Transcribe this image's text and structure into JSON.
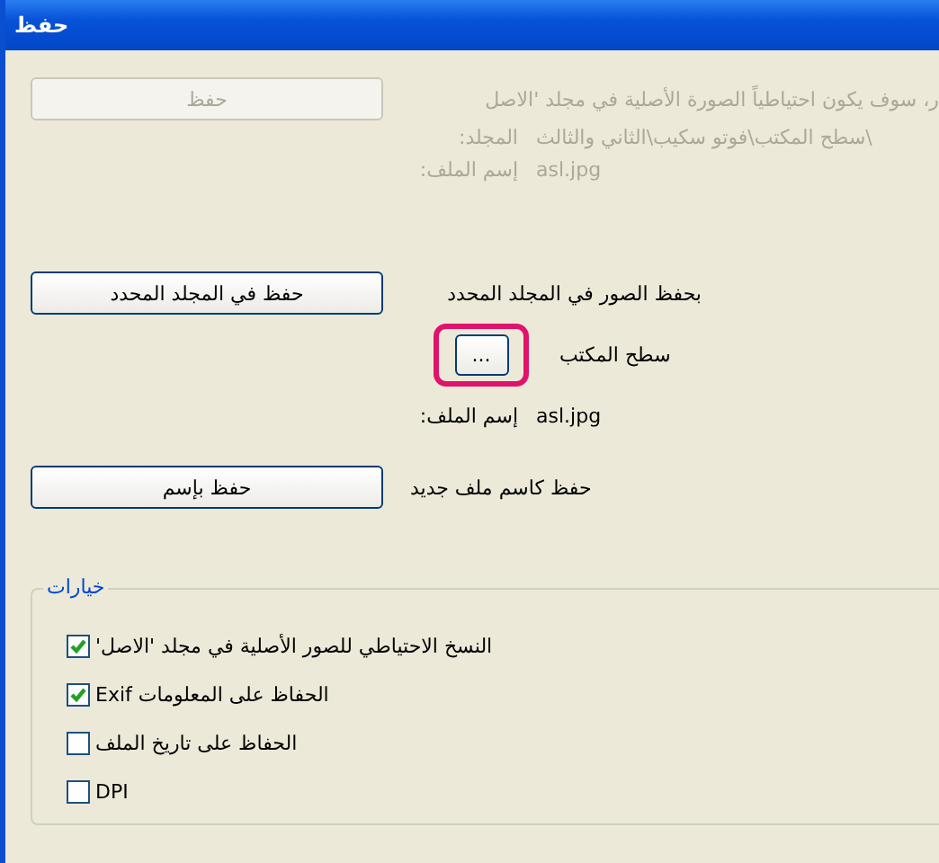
{
  "window": {
    "title": "حفظ"
  },
  "overwrite": {
    "disabled": true,
    "button": "حفظ",
    "description": "ر، سوف يكون احتياطياً الصورة الأصلية في مجلد 'الاصل",
    "fields": [
      {
        "label": "المجلد:",
        "value": "\\سطح المكتب\\فوتو سكيب\\الثاني والثالث"
      },
      {
        "label": "إسم الملف:",
        "value": "asl.jpg"
      }
    ]
  },
  "save_to_folder": {
    "button": "حفظ في المجلد المحدد",
    "description": "بحفظ الصور في المجلد المحدد",
    "folder": "سطح المكتب",
    "browse_button": "...",
    "highlighted": true,
    "fields": [
      {
        "label": "إسم الملف:",
        "value": "asl.jpg"
      }
    ]
  },
  "save_as": {
    "button": "حفظ بإسم",
    "description": "حفظ كاسم ملف جديد"
  },
  "options": {
    "title": "خيارات",
    "items": [
      {
        "label": "النسخ الاحتياطي للصور الأصلية في مجلد 'الاصل'",
        "checked": true
      },
      {
        "label": "الحفاظ على المعلومات Exif",
        "checked": true
      },
      {
        "label": "الحفاظ على تاريخ الملف",
        "checked": false
      },
      {
        "label": "DPI",
        "checked": false
      }
    ]
  }
}
